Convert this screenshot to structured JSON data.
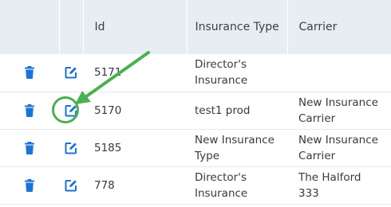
{
  "table": {
    "columns": [
      "",
      "",
      "Id",
      "Insurance Type",
      "Carrier"
    ],
    "rows": [
      {
        "id": "5171",
        "type_line1": "Director's",
        "type_line2": "Insurance",
        "carrier_line1": "",
        "carrier_line2": ""
      },
      {
        "id": "5170",
        "type_line1": "test1 prod",
        "type_line2": "",
        "carrier_line1": "New Insurance",
        "carrier_line2": "Carrier"
      },
      {
        "id": "5185",
        "type_line1": "New Insurance",
        "type_line2": "Type",
        "carrier_line1": "New Insurance",
        "carrier_line2": "Carrier"
      },
      {
        "id": "778",
        "type_line1": "Director's",
        "type_line2": "Insurance",
        "carrier_line1": "The Halford",
        "carrier_line2": "333"
      }
    ]
  },
  "icons": {
    "delete": "trash-icon",
    "edit": "edit-icon",
    "annotation": "arrow-icon"
  },
  "colors": {
    "accent_blue": "#1a73d9",
    "highlight_green": "#4caf50",
    "header_bg": "#e8edf4"
  }
}
